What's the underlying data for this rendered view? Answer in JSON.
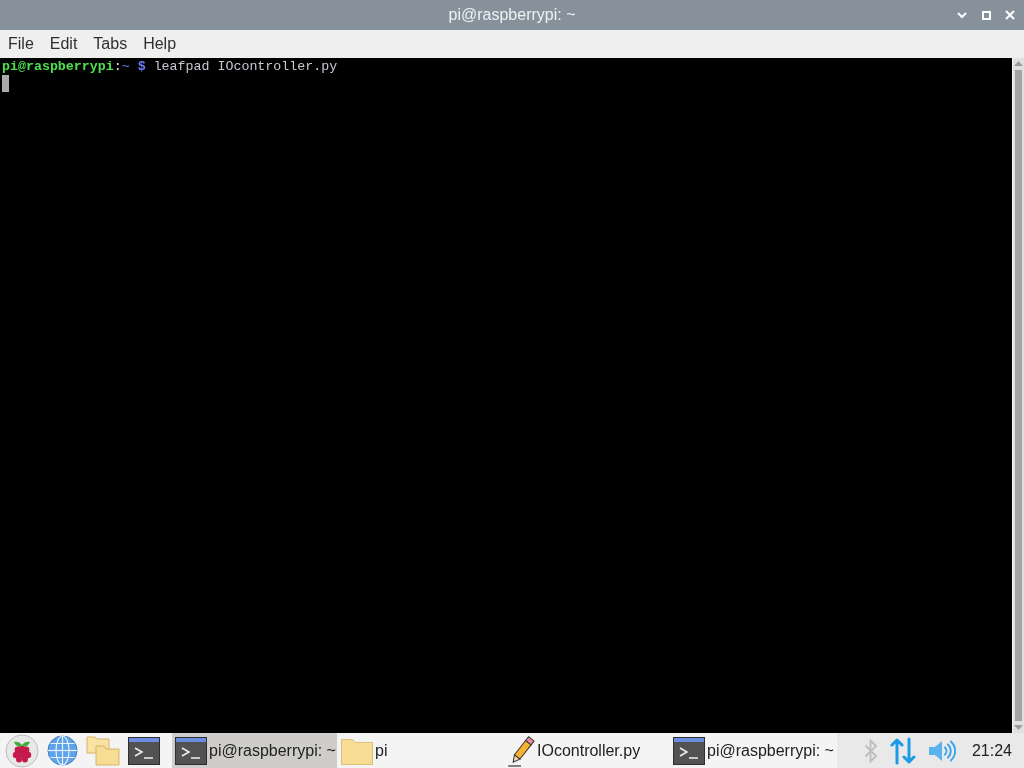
{
  "window": {
    "title": "pi@raspberrypi: ~"
  },
  "menu_bar": [
    "File",
    "Edit",
    "Tabs",
    "Help"
  ],
  "terminal": {
    "lines": [
      {
        "user_host": "pi@raspberrypi",
        "separator": ":",
        "path": "~",
        "prompt": "$",
        "command": "leafpad IOcontroller.py"
      }
    ]
  },
  "taskbar": {
    "launchers": [
      {
        "kind": "menu"
      },
      {
        "kind": "browser"
      },
      {
        "kind": "files"
      },
      {
        "kind": "terminal"
      }
    ],
    "windows": [
      {
        "kind": "terminal",
        "label": "pi@raspberrypi: ~",
        "selected": true
      },
      {
        "kind": "folder",
        "label": "pi",
        "selected": false
      },
      {
        "kind": "editor",
        "label": "IOcontroller.py",
        "selected": false
      },
      {
        "kind": "terminal",
        "label": "pi@raspberrypi: ~",
        "selected": false
      }
    ],
    "tray": {
      "bluetooth_enabled": false,
      "clock": "21:24"
    }
  }
}
